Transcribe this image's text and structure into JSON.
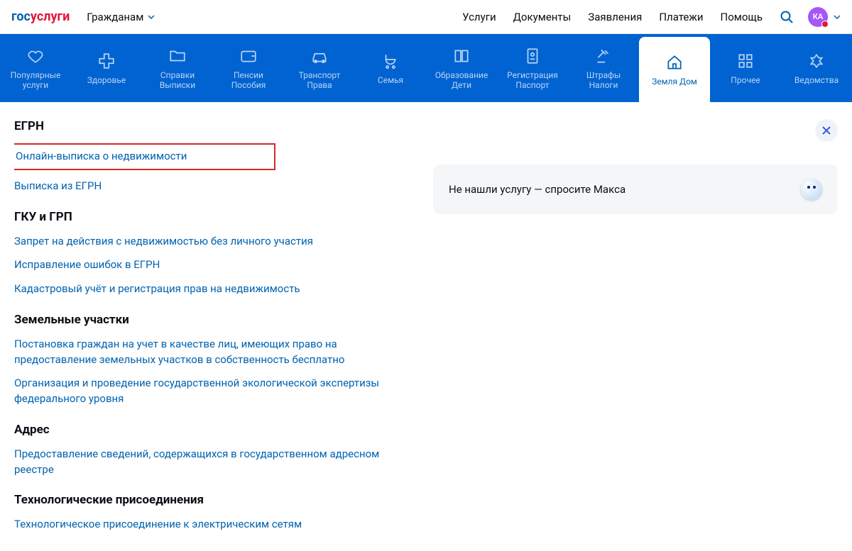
{
  "header": {
    "logo_p1": "гос",
    "logo_p2": "услуги",
    "citizens": "Гражданам",
    "nav": [
      "Услуги",
      "Документы",
      "Заявления",
      "Платежи",
      "Помощь"
    ],
    "avatar_initials": "КА"
  },
  "categories": [
    {
      "label": "Популярные\nуслуги",
      "icon": "heart",
      "active": false
    },
    {
      "label": "Здоровье",
      "icon": "plus",
      "active": false
    },
    {
      "label": "Справки\nВыписки",
      "icon": "folder",
      "active": false
    },
    {
      "label": "Пенсии\nПособия",
      "icon": "wallet",
      "active": false
    },
    {
      "label": "Транспорт\nПрава",
      "icon": "car",
      "active": false
    },
    {
      "label": "Семья",
      "icon": "stroller",
      "active": false
    },
    {
      "label": "Образование\nДети",
      "icon": "book",
      "active": false
    },
    {
      "label": "Регистрация\nПаспорт",
      "icon": "passport",
      "active": false
    },
    {
      "label": "Штрафы\nНалоги",
      "icon": "gavel",
      "active": false
    },
    {
      "label": "Земля Дом",
      "icon": "home",
      "active": true
    },
    {
      "label": "Прочее",
      "icon": "grid",
      "active": false
    },
    {
      "label": "Ведомства",
      "icon": "eagle",
      "active": false
    }
  ],
  "sections": [
    {
      "title": "ЕГРН",
      "links": [
        {
          "text": "Онлайн-выписка о недвижимости",
          "highlighted": true
        },
        {
          "text": "Выписка из ЕГРН"
        }
      ]
    },
    {
      "title": "ГКУ и ГРП",
      "links": [
        {
          "text": "Запрет на действия с недвижимостью без личного участия"
        },
        {
          "text": "Исправление ошибок в ЕГРН"
        },
        {
          "text": "Кадастровый учёт и регистрация прав на недвижимость"
        }
      ]
    },
    {
      "title": "Земельные участки",
      "links": [
        {
          "text": "Постановка граждан на учет в качестве лиц, имеющих право на предоставление земельных участков в собственность бесплатно"
        },
        {
          "text": "Организация и проведение государственной экологической экспертизы федерального уровня"
        }
      ]
    },
    {
      "title": "Адрес",
      "links": [
        {
          "text": "Предоставление сведений, содержащихся в государственном адресном реестре"
        }
      ]
    },
    {
      "title": "Технологические присоединения",
      "links": [
        {
          "text": "Технологическое присоединение к электрическим сетям"
        }
      ]
    }
  ],
  "right": {
    "ask_text": "Не нашли услугу — спросите Макса"
  }
}
